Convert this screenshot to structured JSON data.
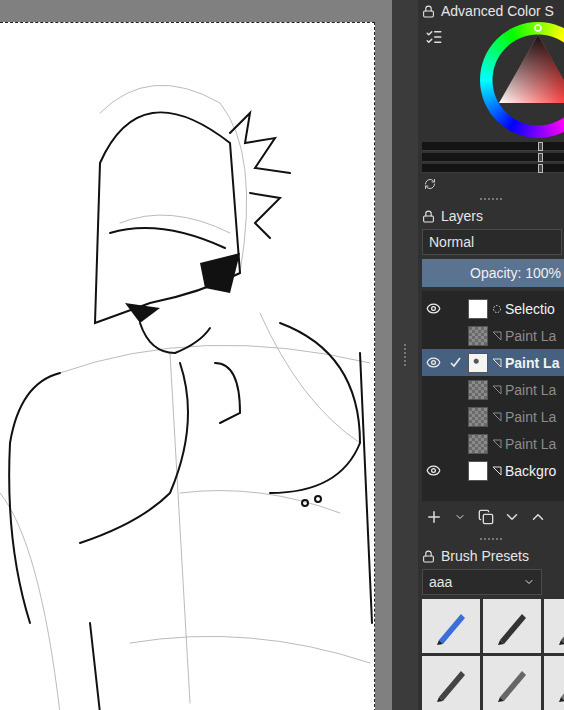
{
  "color_docker": {
    "title": "Advanced Color S"
  },
  "layers_docker": {
    "title": "Layers",
    "blend_mode": "Normal",
    "opacity": "Opacity:  100%",
    "opacity_level": 1,
    "layers": [
      {
        "name": "Selectio",
        "visible": true,
        "checked": false,
        "selected": false,
        "kind": "selection",
        "thumb": "white"
      },
      {
        "name": "Paint La",
        "visible": false,
        "checked": false,
        "selected": false,
        "kind": "paint",
        "thumb": "checker"
      },
      {
        "name": "Paint La",
        "visible": true,
        "checked": true,
        "selected": true,
        "kind": "paint",
        "thumb": "sketch"
      },
      {
        "name": "Paint La",
        "visible": false,
        "checked": false,
        "selected": false,
        "kind": "paint",
        "thumb": "checker"
      },
      {
        "name": "Paint La",
        "visible": false,
        "checked": false,
        "selected": false,
        "kind": "paint",
        "thumb": "checker"
      },
      {
        "name": "Paint La",
        "visible": false,
        "checked": false,
        "selected": false,
        "kind": "paint",
        "thumb": "checker"
      },
      {
        "name": "Backgro",
        "visible": true,
        "checked": false,
        "selected": false,
        "kind": "background",
        "thumb": "white"
      }
    ]
  },
  "brush_docker": {
    "title": "Brush Presets",
    "tag": "aaa"
  }
}
